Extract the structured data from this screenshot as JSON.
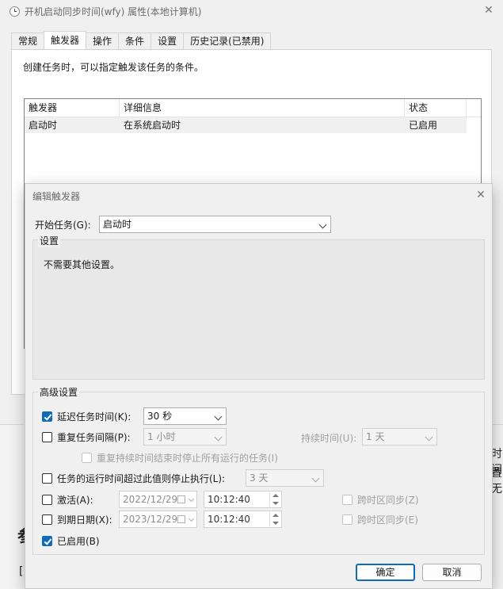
{
  "bg_window": {
    "title": "开机启动同步时间(wfy) 属性(本地计算机)",
    "tabs": [
      "常规",
      "触发器",
      "操作",
      "条件",
      "设置",
      "历史记录(已禁用)"
    ],
    "active_tab": "触发器",
    "description": "创建任务时，可以指定触发该任务的条件。",
    "table": {
      "columns": [
        "触发器",
        "详细信息",
        "状态"
      ],
      "rows": [
        [
          "启动时",
          "在系统启动时",
          "已启用"
        ]
      ]
    },
    "edge_texts": [
      "时间",
      "置无",
      "参",
      "["
    ]
  },
  "dialog": {
    "title": "编辑触发器",
    "begin_task_label": "开始任务(G):",
    "begin_task_value": "启动时",
    "settings_label": "设置",
    "settings_text": "不需要其他设置。",
    "advanced_label": "高级设置",
    "delay": {
      "label": "延迟任务时间(K):",
      "checked": true,
      "value": "30 秒"
    },
    "repeat": {
      "label": "重复任务间隔(P):",
      "checked": false,
      "value": "1 小时",
      "duration_label": "持续时间(U):",
      "duration_value": "1 天"
    },
    "stop_repeat": {
      "label": "重复持续时间结束时停止所有运行的任务(I)",
      "checked": false
    },
    "stop_if_longer": {
      "label": "任务的运行时间超过此值则停止执行(L):",
      "checked": false,
      "value": "3 天"
    },
    "activate": {
      "label": "激活(A):",
      "checked": false,
      "date": "2022/12/29",
      "time": "10:12:40",
      "sync_label": "跨时区同步(Z)"
    },
    "expire": {
      "label": "到期日期(X):",
      "checked": false,
      "date": "2023/12/29",
      "time": "10:12:40",
      "sync_label": "跨时区同步(E)"
    },
    "enabled": {
      "label": "已启用(B)",
      "checked": true
    },
    "ok_label": "确定",
    "cancel_label": "取消"
  },
  "colors": {
    "accent": "#0f6cbd"
  }
}
